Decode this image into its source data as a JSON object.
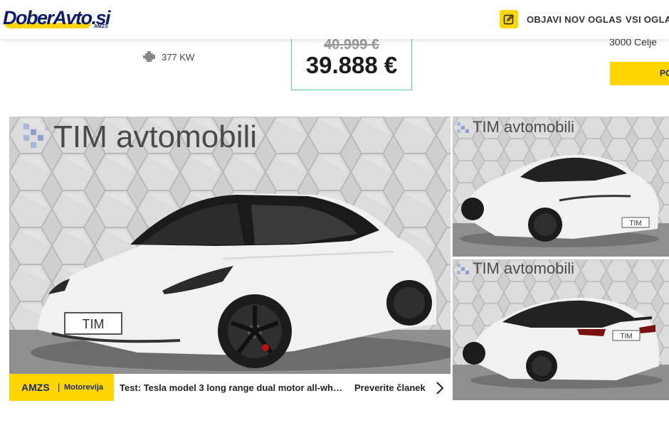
{
  "header": {
    "logo_text": "DoberAvto.si",
    "logo_sub": "AMZS",
    "nav_post_ad": "OBJAVI NOV OGLAS",
    "nav_all_ads": "VSI OGLAS"
  },
  "specs": {
    "engine_icon": "engine-icon",
    "power": "377 KW"
  },
  "price": {
    "old": "40.999 €",
    "current": "39.888 €"
  },
  "seller": {
    "location": "3000 Celje",
    "cta_label": "PO"
  },
  "gallery": {
    "watermark": "TIM avtomobili",
    "plate_text": "TIM"
  },
  "news": {
    "brand": "AMZS",
    "separator": "|",
    "section": "Motorevija",
    "headline": "Test: Tesla model 3 long range dual motor all-wheel drive",
    "link": "Preverite članek"
  },
  "colors": {
    "brand_yellow": "#ffd600",
    "brand_navy": "#0d1c6b",
    "price_border": "#5ccf94"
  }
}
